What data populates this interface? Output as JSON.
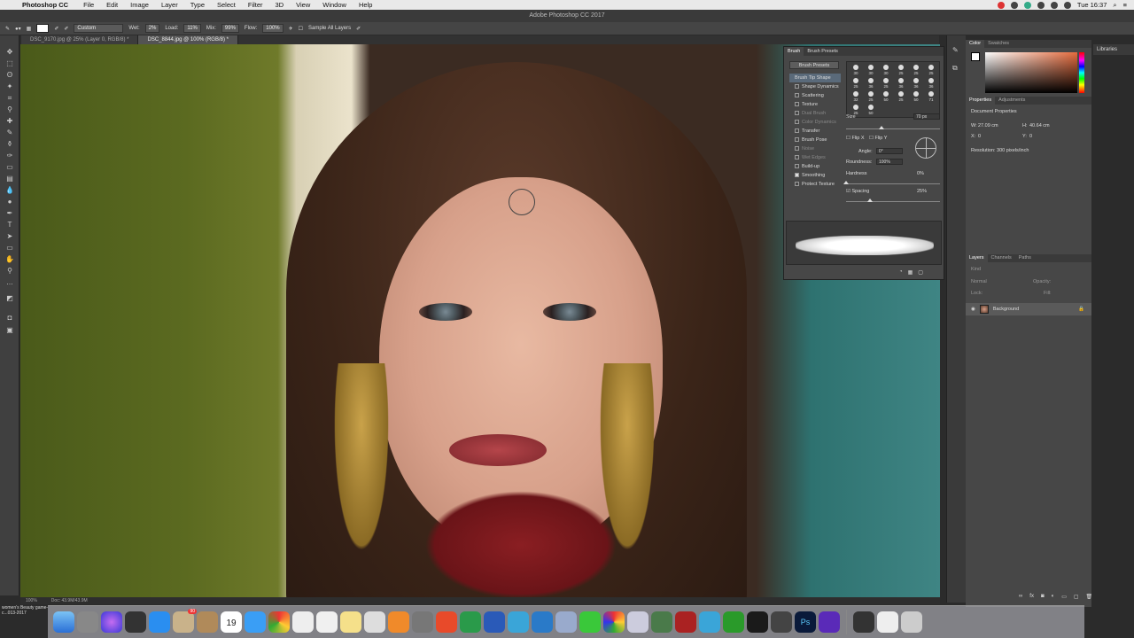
{
  "menubar": {
    "app_name": "Photoshop CC",
    "items": [
      "File",
      "Edit",
      "Image",
      "Layer",
      "Type",
      "Select",
      "Filter",
      "3D",
      "View",
      "Window",
      "Help"
    ],
    "clock": "Tue 16:37"
  },
  "titlebar": {
    "title": "Adobe Photoshop CC 2017"
  },
  "options": {
    "preset": "Custom",
    "wet_label": "Wet:",
    "wet_value": "2%",
    "load_label": "Load:",
    "load_value": "11%",
    "mix_label": "Mix:",
    "mix_value": "99%",
    "flow_label": "Flow:",
    "flow_value": "100%",
    "sample_label": "Sample All Layers"
  },
  "doc_tabs": [
    {
      "label": "DSC_9170.jpg @ 25% (Layer 0, RGB/8) *",
      "active": false
    },
    {
      "label": "DSC_8844.jpg @ 100% (RGB/8) *",
      "active": true
    }
  ],
  "status": {
    "zoom": "100%",
    "doc": "Doc: 43.9M/43.9M"
  },
  "brush_panel": {
    "tabs": [
      "Brush",
      "Brush Presets"
    ],
    "presets_button": "Brush Presets",
    "options": [
      {
        "label": "Brush Tip Shape",
        "state": "selected"
      },
      {
        "label": "Shape Dynamics",
        "state": "on"
      },
      {
        "label": "Scattering",
        "state": "on"
      },
      {
        "label": "Texture",
        "state": "on"
      },
      {
        "label": "Dual Brush",
        "state": "dim"
      },
      {
        "label": "Color Dynamics",
        "state": "dim"
      },
      {
        "label": "Transfer",
        "state": "on"
      },
      {
        "label": "Brush Pose",
        "state": "on"
      },
      {
        "label": "Noise",
        "state": "dim"
      },
      {
        "label": "Wet Edges",
        "state": "dim"
      },
      {
        "label": "Build-up",
        "state": "on"
      },
      {
        "label": "Smoothing",
        "state": "checked"
      },
      {
        "label": "Protect Texture",
        "state": "on"
      }
    ],
    "brush_sizes": [
      "30",
      "30",
      "30",
      "25",
      "25",
      "25",
      "25",
      "36",
      "25",
      "36",
      "36",
      "36",
      "32",
      "25",
      "50",
      "25",
      "50",
      "71",
      "25",
      "50"
    ],
    "size_label": "Size",
    "size_value": "70 px",
    "flip_x": "Flip X",
    "flip_y": "Flip Y",
    "angle_label": "Angle:",
    "angle_value": "0°",
    "roundness_label": "Roundness:",
    "roundness_value": "100%",
    "hardness_label": "Hardness",
    "hardness_value": "0%",
    "spacing_label": "Spacing",
    "spacing_value": "25%"
  },
  "color_panel": {
    "tabs": [
      "Color",
      "Swatches"
    ]
  },
  "properties_panel": {
    "tabs": [
      "Properties",
      "Adjustments"
    ],
    "title": "Document Properties",
    "w_label": "W:",
    "w_value": "27.09 cm",
    "h_label": "H:",
    "h_value": "40.64 cm",
    "x_label": "X:",
    "x_value": "0",
    "y_label": "Y:",
    "y_value": "0",
    "resolution": "Resolution: 300 pixels/inch"
  },
  "layers_panel": {
    "tabs": [
      "Layers",
      "Channels",
      "Paths"
    ],
    "kind": "Kind",
    "mode": "Normal",
    "opacity_label": "Opacity:",
    "lock_label": "Lock:",
    "fill_label": "Fill:",
    "layer_name": "Background"
  },
  "libraries": {
    "label": "Libraries"
  },
  "dock": {
    "desktop_label": "women's Beauty game-c...013-2017",
    "calendar_day": "19",
    "mail_badge": "90"
  }
}
